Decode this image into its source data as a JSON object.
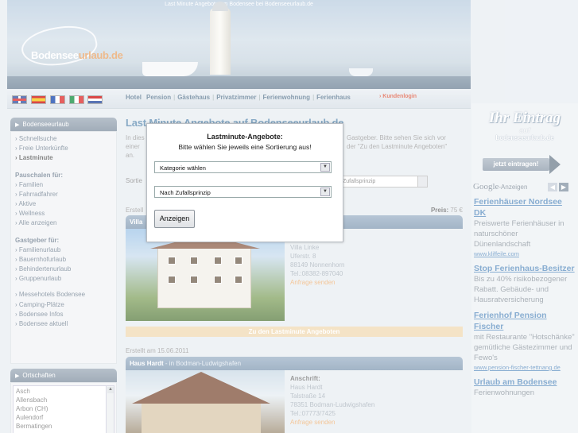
{
  "header": {
    "tagline": "Last Minute Angebote am Bodensee bei Bodenseeurlaub.de",
    "logo_text_a": "Bodensee",
    "logo_text_b": "urlaub.de"
  },
  "topmenu": {
    "items": [
      "Hotel",
      "Pension",
      "Gästehaus",
      "Privatzimmer",
      "Ferienwohnung",
      "Ferienhaus"
    ],
    "kundenlogin": "› Kundenlogin"
  },
  "sidebar": {
    "section1_title": "Bodenseeurlaub",
    "items1": [
      "› Schnellsuche",
      "› Freie Unterkünfte",
      "› Lastminute"
    ],
    "pauschalen_title": "Pauschalen für:",
    "pauschalen": [
      "› Familien",
      "› Fahrradfahrer",
      "› Aktive",
      "› Wellness",
      "› Alle anzeigen"
    ],
    "gastgeber_title": "Gastgeber für:",
    "gastgeber": [
      "› Familienurlaub",
      "› Bauernhofurlaub",
      "› Behindertenurlaub",
      "› Gruppenurlaub"
    ],
    "misc": [
      "› Messehotels Bodensee",
      "› Camping-Plätze",
      "› Bodensee Infos",
      "› Bodensee aktuell"
    ],
    "orte_title": "Ortschaften",
    "orte": [
      "Asch",
      "Allensbach",
      "Arbon (CH)",
      "Aulendorf",
      "Bermatingen"
    ]
  },
  "main": {
    "heading": "Last Minute Angebote auf Bodenseeurlaub.de",
    "intro_left": "In dies\neiner\nan.",
    "intro_right": "Gastgeber. Bitte sehen Sie sich vor\nder \"Zu den Lastminute Angeboten\"",
    "sort_label": "Sortie",
    "sort_value": "Zufallsprinzip",
    "offer1": {
      "created": "Erstell",
      "price_label": "Preis:",
      "price_value": "75 €",
      "bar_title": "Villa",
      "address": [
        "Villa Linke",
        "Uferstr. 8",
        "88149 Nonnenhorn",
        "Tel.:08382-897040"
      ],
      "send_link": "Anfrage senden"
    },
    "zu_button": "Zu den Lastminute Angeboten",
    "offer2": {
      "created": "Erstellt am 15.06.2011",
      "bar_title": "Haus Hardt",
      "bar_loc": " - in Bodman-Ludwigshafen",
      "address_head": "Anschrift:",
      "address": [
        "Haus Hardt",
        "Talstraße 14",
        "78351 Bodman-Ludwigshafen",
        "Tel.:07773/7425"
      ],
      "send_link": "Anfrage senden"
    }
  },
  "right": {
    "eintrag_big": "Ihr Eintrag",
    "eintrag_auf": "auf",
    "eintrag_site": "bodenseeurlaub.de",
    "eintrag_button": "jetzt eintragen!",
    "google_brand": "Google",
    "google_ads_label": "-Anzeigen",
    "ads": [
      {
        "title": "Ferienhäuser Nordsee DK",
        "desc": "Preiswerte Ferienhäuser in naturschöner Dünenlandschaft",
        "url": "www.kliffeile.com"
      },
      {
        "title": "Stop Ferienhaus-Besitzer",
        "desc": "Bis zu 40% risikobezogener Rabatt. Gebäude- und Hausratversicherung",
        "url": ""
      },
      {
        "title": "Ferienhof Pension Fischer",
        "desc": "mit Restaurante \"Hotschänke\" gemütliche Gästezimmer und Fewo's",
        "url": "www.pension-fischer-tettnang.de"
      },
      {
        "title": "Urlaub am Bodensee",
        "desc": "Ferienwohnungen",
        "url": ""
      }
    ]
  },
  "modal": {
    "title": "Lastminute-Angebote:",
    "subtitle": "Bitte wählen Sie jeweils eine Sortierung aus!",
    "select1_value": "Kategorie wählen",
    "select2_value": "Nach Zufallsprinzip",
    "button_label": "Anzeigen"
  },
  "colors": {
    "link_blue": "#5a8ec0",
    "heading_blue": "#5a8ab0",
    "bar_blue": "#8fa7bf",
    "accent_orange": "#f0b070",
    "login_red": "#e05a40"
  }
}
